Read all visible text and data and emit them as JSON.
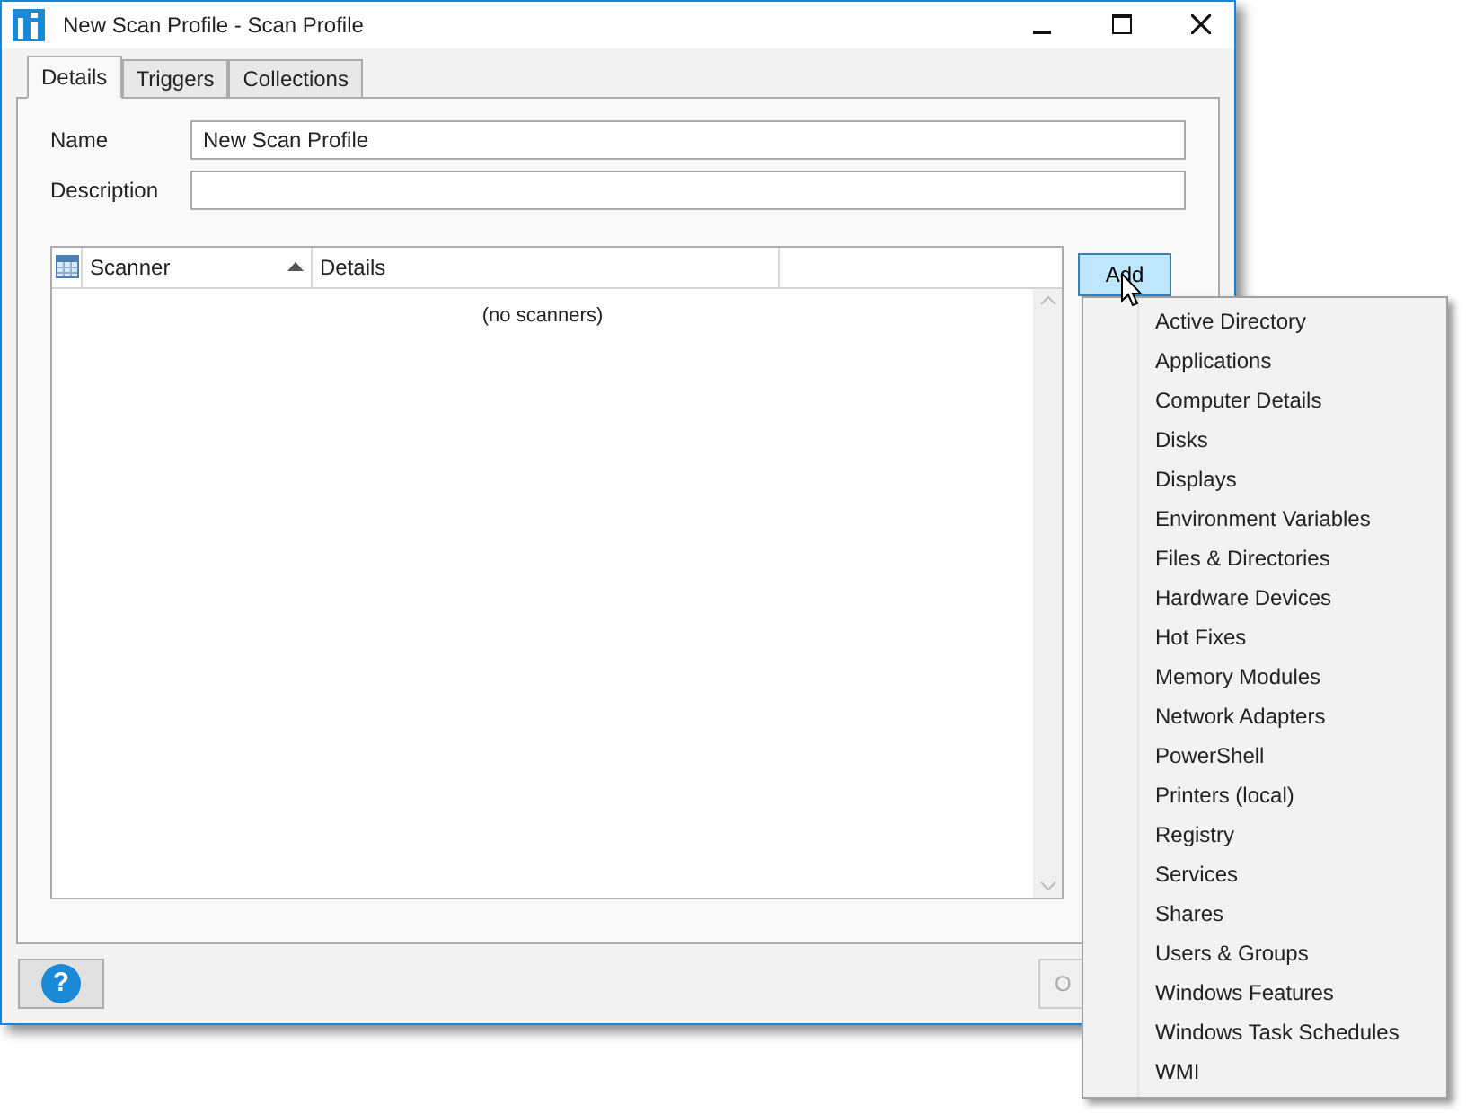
{
  "window": {
    "title": "New Scan Profile - Scan Profile"
  },
  "tabs": [
    {
      "label": "Details",
      "selected": true
    },
    {
      "label": "Triggers",
      "selected": false
    },
    {
      "label": "Collections",
      "selected": false
    }
  ],
  "fields": [
    {
      "label": "Name",
      "value": "New Scan Profile"
    },
    {
      "label": "Description"
    }
  ],
  "table": {
    "columns": [
      {
        "label": "Scanner",
        "sorted": true
      },
      {
        "label": "Details",
        "sorted": false
      }
    ],
    "empty_text": "(no scanners)"
  },
  "add_button": {
    "label": "Add",
    "hovered": true
  },
  "help_button": {
    "label": "?"
  },
  "ok_button": {
    "label": "O"
  },
  "menu": {
    "items": [
      "Active Directory",
      "Applications",
      "Computer Details",
      "Disks",
      "Displays",
      "Environment Variables",
      "Files & Directories",
      "Hardware Devices",
      "Hot Fixes",
      "Memory Modules",
      "Network Adapters",
      "PowerShell",
      "Printers (local)",
      "Registry",
      "Services",
      "Shares",
      "Users & Groups",
      "Windows Features",
      "Windows Task Schedules",
      "WMI"
    ]
  }
}
